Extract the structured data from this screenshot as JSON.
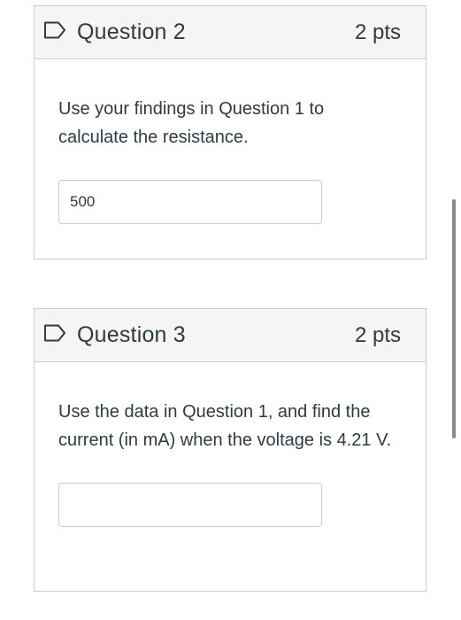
{
  "questions": [
    {
      "title": "Question 2",
      "points": "2 pts",
      "text": "Use your findings in Question 1 to calculate the resistance.",
      "answer_value": "500",
      "answer_placeholder": ""
    },
    {
      "title": "Question 3",
      "points": "2 pts",
      "text": "Use the data in Question 1, and find the current (in mA) when the voltage is 4.21 V.",
      "answer_value": "",
      "answer_placeholder": ""
    }
  ],
  "icons": {
    "flag": "flag-outline-icon"
  },
  "colors": {
    "border": "#c7cdd1",
    "header_bg": "#f5f5f5",
    "text": "#2d3b45"
  }
}
